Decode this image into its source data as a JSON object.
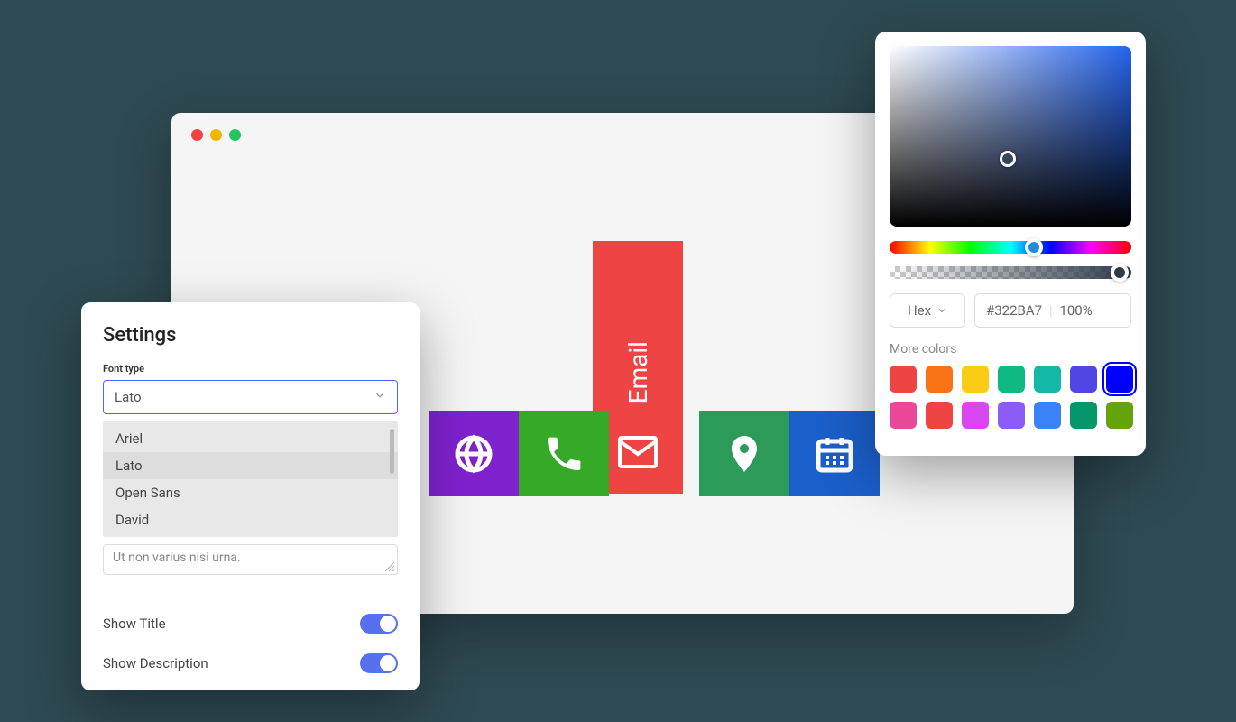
{
  "browser": {
    "icons": [
      {
        "name": "globe",
        "bg": "#7e22ce"
      },
      {
        "name": "phone",
        "bg": "#36aa28"
      },
      {
        "name": "email",
        "bg": "#ef4444",
        "label": "Email"
      },
      {
        "name": "location",
        "bg": "#2c9b5a"
      },
      {
        "name": "calendar",
        "bg": "#1b5fca"
      }
    ]
  },
  "settings": {
    "title": "Settings",
    "fontTypeLabel": "Font type",
    "selectedFont": "Lato",
    "fontOptions": [
      "Ariel",
      "Lato",
      "Open Sans",
      "David"
    ],
    "textareaText": "Ut non varius nisi urna.",
    "toggles": [
      {
        "label": "Show Title",
        "on": true
      },
      {
        "label": "Show Description",
        "on": true
      }
    ]
  },
  "colorPicker": {
    "format": "Hex",
    "hex": "#322BA7",
    "alpha": "100%",
    "moreLabel": "More colors",
    "swatches": [
      {
        "c": "#ef4444"
      },
      {
        "c": "#f97316"
      },
      {
        "c": "#facc15"
      },
      {
        "c": "#10b981"
      },
      {
        "c": "#14b8a6"
      },
      {
        "c": "#4f46e5"
      },
      {
        "c": "#0000ff",
        "selected": true
      },
      {
        "c": "#ec4899"
      },
      {
        "c": "#ef4444"
      },
      {
        "c": "#d946ef"
      },
      {
        "c": "#8b5cf6"
      },
      {
        "c": "#3b82f6"
      },
      {
        "c": "#059669"
      },
      {
        "c": "#65a30d"
      }
    ]
  }
}
